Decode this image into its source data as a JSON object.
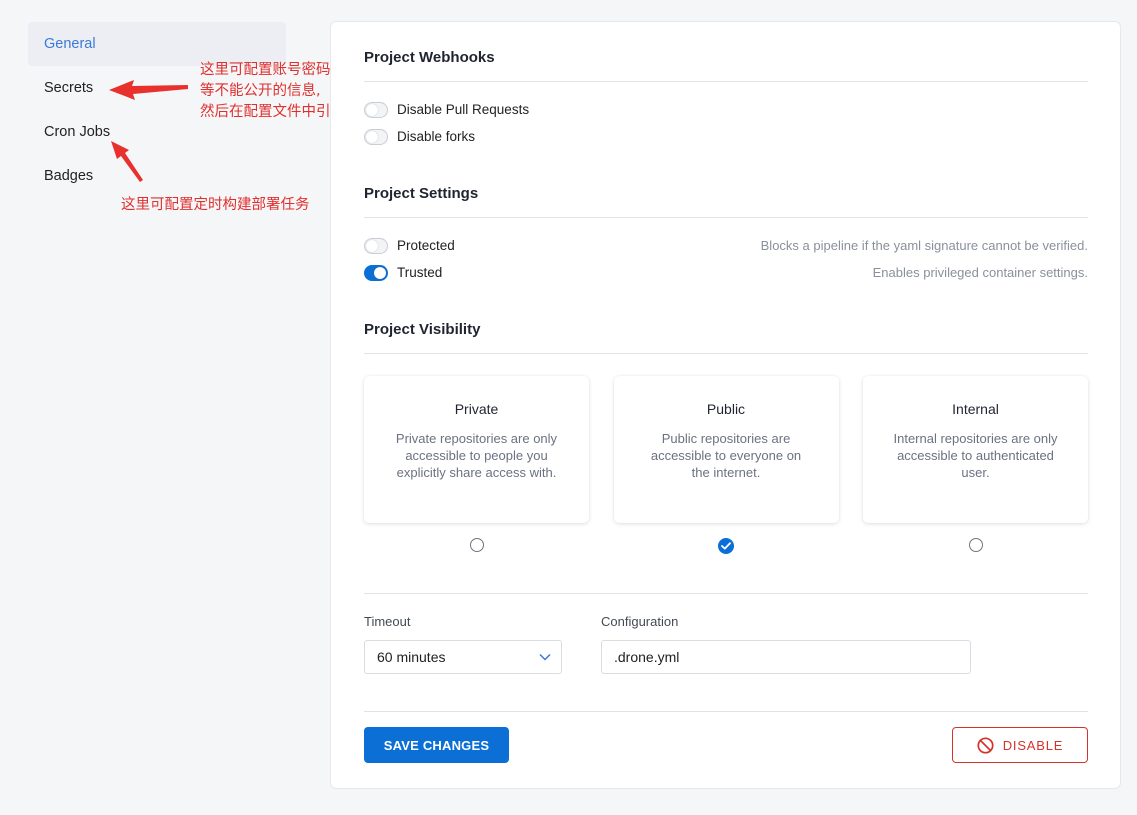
{
  "sidebar": {
    "items": [
      {
        "label": "General"
      },
      {
        "label": "Secrets"
      },
      {
        "label": "Cron Jobs"
      },
      {
        "label": "Badges"
      }
    ]
  },
  "annotations": {
    "secrets_note": [
      "这里可配置账号密码",
      "等不能公开的信息,",
      "然后在配置文件中引用"
    ],
    "cron_note": "这里可配置定时构建部署任务"
  },
  "webhooks": {
    "title": "Project Webhooks",
    "disable_pull_requests": {
      "label": "Disable Pull Requests",
      "enabled": false
    },
    "disable_forks": {
      "label": "Disable forks",
      "enabled": false
    }
  },
  "settings": {
    "title": "Project Settings",
    "protected": {
      "label": "Protected",
      "hint": "Blocks a pipeline if the yaml signature cannot be verified.",
      "enabled": false
    },
    "trusted": {
      "label": "Trusted",
      "hint": "Enables privileged container settings.",
      "enabled": true
    }
  },
  "visibility": {
    "title": "Project Visibility",
    "selected": "Public",
    "options": [
      {
        "title": "Private",
        "desc": "Private repositories are only accessible to people you explicitly share access with."
      },
      {
        "title": "Public",
        "desc": "Public repositories are accessible to everyone on the internet."
      },
      {
        "title": "Internal",
        "desc": "Internal repositories are only accessible to authenticated user."
      }
    ]
  },
  "form": {
    "timeout_label": "Timeout",
    "timeout_value": "60 minutes",
    "configuration_label": "Configuration",
    "configuration_value": ".drone.yml"
  },
  "actions": {
    "save_label": "SAVE CHANGES",
    "disable_label": "DISABLE"
  },
  "colors": {
    "accent": "#0b6fd6",
    "danger": "#d5322c",
    "annotation": "#e0302e",
    "sidebar_active_text": "#3b7ad9"
  },
  "icons": {
    "select": "chevron-down-icon",
    "radio_checked": "check-icon",
    "disable": "ban-icon"
  }
}
